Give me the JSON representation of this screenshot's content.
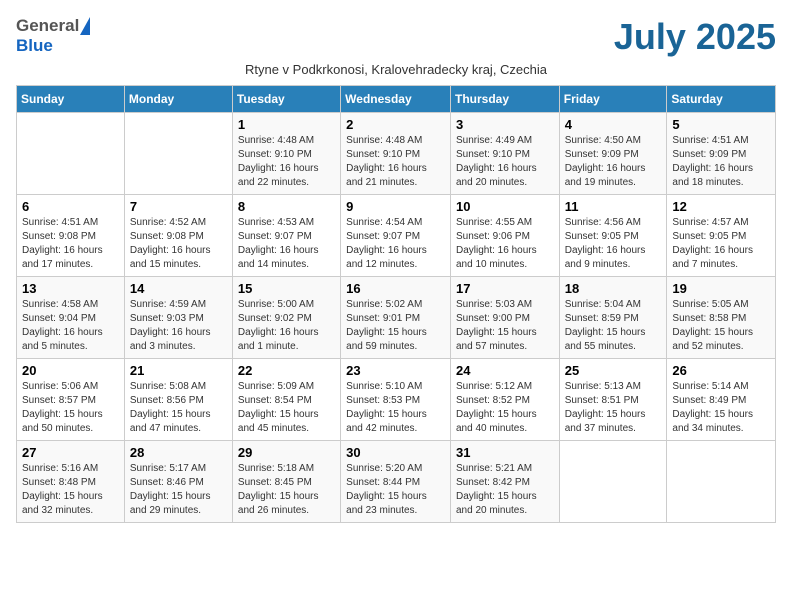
{
  "header": {
    "logo_general": "General",
    "logo_blue": "Blue",
    "month_year": "July 2025",
    "subtitle": "Rtyne v Podkrkonosi, Kralovehradecky kraj, Czechia"
  },
  "days_of_week": [
    "Sunday",
    "Monday",
    "Tuesday",
    "Wednesday",
    "Thursday",
    "Friday",
    "Saturday"
  ],
  "weeks": [
    [
      {
        "day": "",
        "info": ""
      },
      {
        "day": "",
        "info": ""
      },
      {
        "day": "1",
        "info": "Sunrise: 4:48 AM\nSunset: 9:10 PM\nDaylight: 16 hours\nand 22 minutes."
      },
      {
        "day": "2",
        "info": "Sunrise: 4:48 AM\nSunset: 9:10 PM\nDaylight: 16 hours\nand 21 minutes."
      },
      {
        "day": "3",
        "info": "Sunrise: 4:49 AM\nSunset: 9:10 PM\nDaylight: 16 hours\nand 20 minutes."
      },
      {
        "day": "4",
        "info": "Sunrise: 4:50 AM\nSunset: 9:09 PM\nDaylight: 16 hours\nand 19 minutes."
      },
      {
        "day": "5",
        "info": "Sunrise: 4:51 AM\nSunset: 9:09 PM\nDaylight: 16 hours\nand 18 minutes."
      }
    ],
    [
      {
        "day": "6",
        "info": "Sunrise: 4:51 AM\nSunset: 9:08 PM\nDaylight: 16 hours\nand 17 minutes."
      },
      {
        "day": "7",
        "info": "Sunrise: 4:52 AM\nSunset: 9:08 PM\nDaylight: 16 hours\nand 15 minutes."
      },
      {
        "day": "8",
        "info": "Sunrise: 4:53 AM\nSunset: 9:07 PM\nDaylight: 16 hours\nand 14 minutes."
      },
      {
        "day": "9",
        "info": "Sunrise: 4:54 AM\nSunset: 9:07 PM\nDaylight: 16 hours\nand 12 minutes."
      },
      {
        "day": "10",
        "info": "Sunrise: 4:55 AM\nSunset: 9:06 PM\nDaylight: 16 hours\nand 10 minutes."
      },
      {
        "day": "11",
        "info": "Sunrise: 4:56 AM\nSunset: 9:05 PM\nDaylight: 16 hours\nand 9 minutes."
      },
      {
        "day": "12",
        "info": "Sunrise: 4:57 AM\nSunset: 9:05 PM\nDaylight: 16 hours\nand 7 minutes."
      }
    ],
    [
      {
        "day": "13",
        "info": "Sunrise: 4:58 AM\nSunset: 9:04 PM\nDaylight: 16 hours\nand 5 minutes."
      },
      {
        "day": "14",
        "info": "Sunrise: 4:59 AM\nSunset: 9:03 PM\nDaylight: 16 hours\nand 3 minutes."
      },
      {
        "day": "15",
        "info": "Sunrise: 5:00 AM\nSunset: 9:02 PM\nDaylight: 16 hours\nand 1 minute."
      },
      {
        "day": "16",
        "info": "Sunrise: 5:02 AM\nSunset: 9:01 PM\nDaylight: 15 hours\nand 59 minutes."
      },
      {
        "day": "17",
        "info": "Sunrise: 5:03 AM\nSunset: 9:00 PM\nDaylight: 15 hours\nand 57 minutes."
      },
      {
        "day": "18",
        "info": "Sunrise: 5:04 AM\nSunset: 8:59 PM\nDaylight: 15 hours\nand 55 minutes."
      },
      {
        "day": "19",
        "info": "Sunrise: 5:05 AM\nSunset: 8:58 PM\nDaylight: 15 hours\nand 52 minutes."
      }
    ],
    [
      {
        "day": "20",
        "info": "Sunrise: 5:06 AM\nSunset: 8:57 PM\nDaylight: 15 hours\nand 50 minutes."
      },
      {
        "day": "21",
        "info": "Sunrise: 5:08 AM\nSunset: 8:56 PM\nDaylight: 15 hours\nand 47 minutes."
      },
      {
        "day": "22",
        "info": "Sunrise: 5:09 AM\nSunset: 8:54 PM\nDaylight: 15 hours\nand 45 minutes."
      },
      {
        "day": "23",
        "info": "Sunrise: 5:10 AM\nSunset: 8:53 PM\nDaylight: 15 hours\nand 42 minutes."
      },
      {
        "day": "24",
        "info": "Sunrise: 5:12 AM\nSunset: 8:52 PM\nDaylight: 15 hours\nand 40 minutes."
      },
      {
        "day": "25",
        "info": "Sunrise: 5:13 AM\nSunset: 8:51 PM\nDaylight: 15 hours\nand 37 minutes."
      },
      {
        "day": "26",
        "info": "Sunrise: 5:14 AM\nSunset: 8:49 PM\nDaylight: 15 hours\nand 34 minutes."
      }
    ],
    [
      {
        "day": "27",
        "info": "Sunrise: 5:16 AM\nSunset: 8:48 PM\nDaylight: 15 hours\nand 32 minutes."
      },
      {
        "day": "28",
        "info": "Sunrise: 5:17 AM\nSunset: 8:46 PM\nDaylight: 15 hours\nand 29 minutes."
      },
      {
        "day": "29",
        "info": "Sunrise: 5:18 AM\nSunset: 8:45 PM\nDaylight: 15 hours\nand 26 minutes."
      },
      {
        "day": "30",
        "info": "Sunrise: 5:20 AM\nSunset: 8:44 PM\nDaylight: 15 hours\nand 23 minutes."
      },
      {
        "day": "31",
        "info": "Sunrise: 5:21 AM\nSunset: 8:42 PM\nDaylight: 15 hours\nand 20 minutes."
      },
      {
        "day": "",
        "info": ""
      },
      {
        "day": "",
        "info": ""
      }
    ]
  ]
}
